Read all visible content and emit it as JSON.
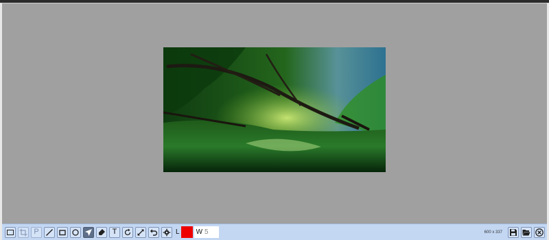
{
  "canvas": {
    "image_alt": "river forest photograph"
  },
  "toolbar": {
    "tools": [
      {
        "name": "select-rect-tool",
        "icon": "rectangle-select-icon",
        "state": "normal"
      },
      {
        "name": "crop-tool",
        "icon": "crop-icon",
        "state": "disabled"
      },
      {
        "name": "pen-tool",
        "icon": "pen-p-icon",
        "label": "P",
        "state": "disabled"
      },
      {
        "name": "line-tool",
        "icon": "line-icon",
        "state": "normal"
      },
      {
        "name": "rectangle-tool",
        "icon": "rectangle-icon",
        "state": "normal"
      },
      {
        "name": "ellipse-tool",
        "icon": "ellipse-icon",
        "state": "normal"
      },
      {
        "name": "arrow-tool",
        "icon": "arrow-pointer-icon",
        "state": "active"
      },
      {
        "name": "highlighter-tool",
        "icon": "highlighter-icon",
        "state": "normal"
      },
      {
        "name": "text-tool",
        "icon": "text-icon",
        "label": "T",
        "state": "normal"
      },
      {
        "name": "rotate-tool",
        "icon": "rotate-icon",
        "state": "normal"
      },
      {
        "name": "resize-tool",
        "icon": "resize-icon",
        "state": "normal"
      },
      {
        "name": "undo-tool",
        "icon": "undo-icon",
        "state": "normal"
      },
      {
        "name": "settings-tool",
        "icon": "gear-icon",
        "state": "normal"
      }
    ],
    "line_label": "L",
    "stroke_color": "#ee0000",
    "width_label": "W",
    "width_value": "5",
    "dimensions": "600 x 337",
    "save_icon": "save-icon",
    "open_icon": "folder-open-icon",
    "close_icon": "close-icon"
  }
}
